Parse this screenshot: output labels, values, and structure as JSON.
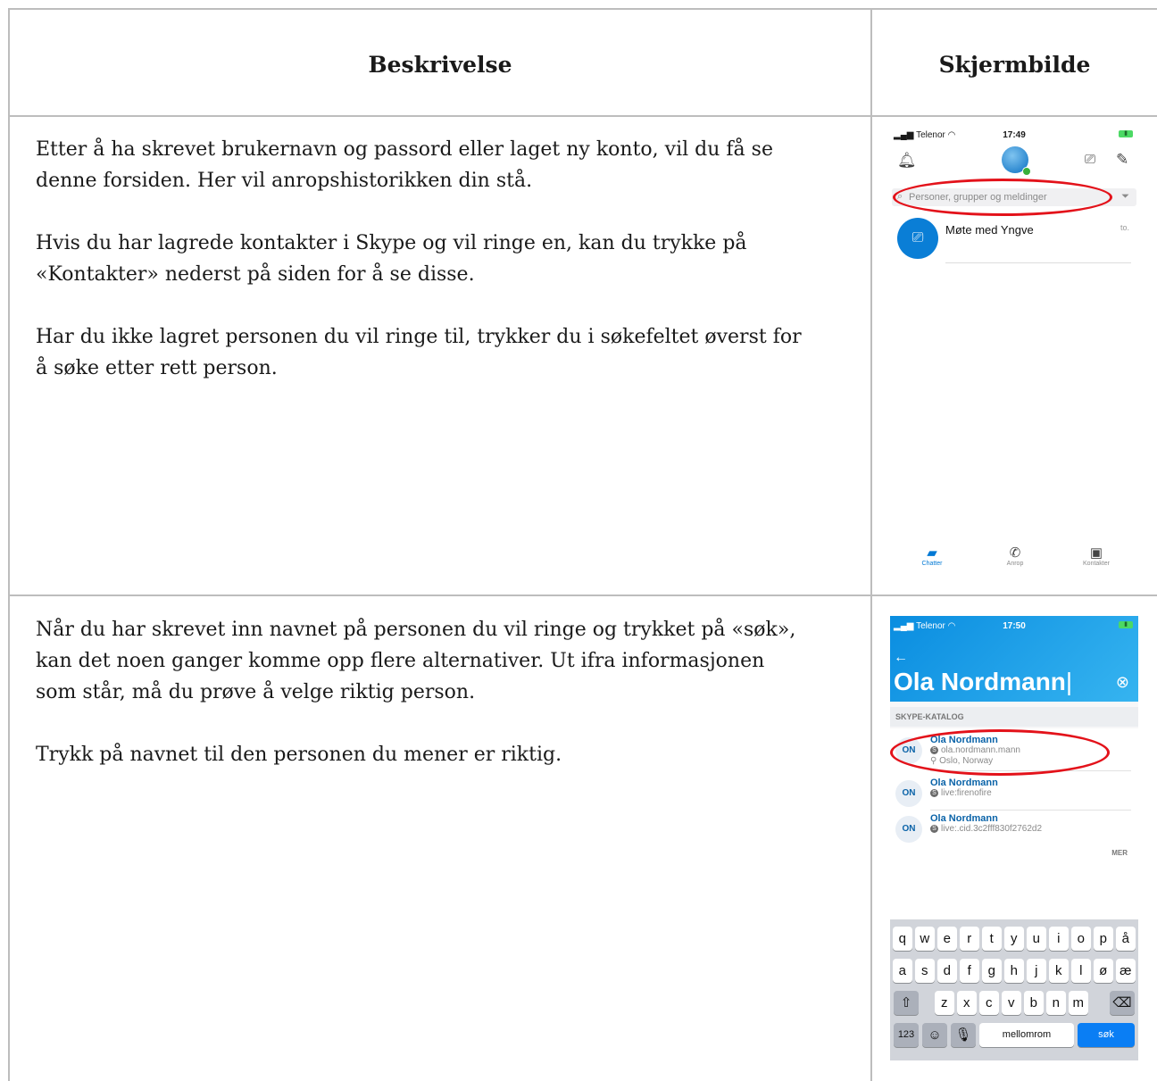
{
  "headers": {
    "description": "Beskrivelse",
    "screenshot": "Skjermbilde"
  },
  "row1": {
    "paragraphs": [
      "Etter å ha skrevet brukernavn og passord eller laget ny konto, vil du få se denne forsiden. Her vil anropshistorikken din stå.",
      "Hvis du har lagrede kontakter i Skype og vil ringe en, kan du trykke på «Kontakter» nederst på siden for å se disse.",
      "Har du ikke lagret personen du vil ringe til, trykker du i søkefeltet øverst for å søke etter rett person."
    ],
    "phone": {
      "carrier": "Telenor",
      "time": "17:49",
      "search_placeholder": "Personer, grupper og meldinger",
      "chat_name": "Møte med Yngve",
      "chat_time": "to.",
      "tabs": [
        "Chatter",
        "Anrop",
        "Kontakter"
      ],
      "active_color": "#0078d4"
    }
  },
  "row2": {
    "paragraphs": [
      "Når du har skrevet inn navnet på personen du vil ringe og trykket på «søk», kan det noen ganger komme opp flere alternativer. Ut ifra informasjonen som står, må du prøve å velge riktig person.",
      "Trykk på navnet til den personen du mener er riktig."
    ],
    "phone": {
      "carrier": "Telenor",
      "time": "17:50",
      "query": "Ola Nordmann",
      "section": "SKYPE-KATALOG",
      "results": [
        {
          "initials": "ON",
          "name": "Ola Nordmann",
          "id": "ola.nordmann.mann",
          "location": "Oslo, Norway"
        },
        {
          "initials": "ON",
          "name": "Ola Nordmann",
          "id": "live:firenofire",
          "location": ""
        },
        {
          "initials": "ON",
          "name": "Ola Nordmann",
          "id": "live:.cid.3c2fff830f2762d2",
          "location": ""
        }
      ],
      "more": "MER",
      "keyboard": {
        "row1": [
          "q",
          "w",
          "e",
          "r",
          "t",
          "y",
          "u",
          "i",
          "o",
          "p",
          "å"
        ],
        "row2": [
          "a",
          "s",
          "d",
          "f",
          "g",
          "h",
          "j",
          "k",
          "l",
          "ø",
          "æ"
        ],
        "row3": [
          "z",
          "x",
          "c",
          "v",
          "b",
          "n",
          "m"
        ],
        "num": "123",
        "space": "mellomrom",
        "go": "søk"
      },
      "header_color": "#0a8de0"
    }
  }
}
